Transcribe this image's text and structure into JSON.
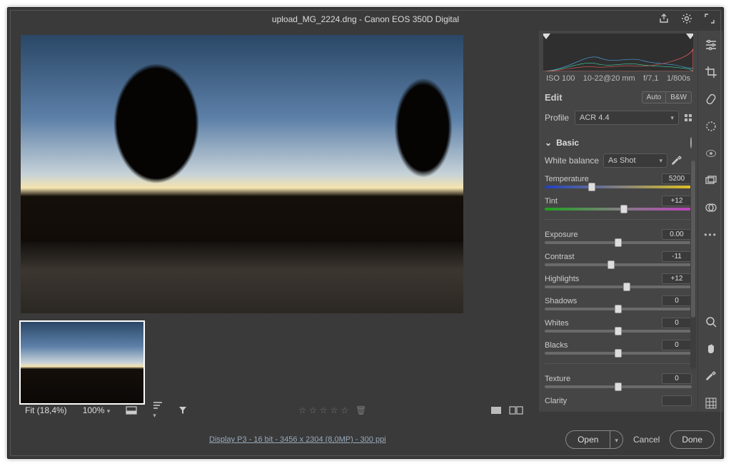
{
  "title": {
    "filename": "upload_MG_2224.dng",
    "sep": " - ",
    "camera": "Canon EOS 350D Digital"
  },
  "meta": {
    "iso": "ISO 100",
    "lens": "10-22@20 mm",
    "aperture": "f/7,1",
    "shutter": "1/800s"
  },
  "edit": {
    "label": "Edit",
    "auto": "Auto",
    "bw": "B&W",
    "profile_label": "Profile",
    "profile_value": "ACR 4.4"
  },
  "basic": {
    "heading": "Basic",
    "wb_label": "White balance",
    "wb_value": "As Shot",
    "sliders": {
      "temperature": {
        "label": "Temperature",
        "value": "5200",
        "pos": 32
      },
      "tint": {
        "label": "Tint",
        "value": "+12",
        "pos": 54
      },
      "exposure": {
        "label": "Exposure",
        "value": "0.00",
        "pos": 50
      },
      "contrast": {
        "label": "Contrast",
        "value": "-11",
        "pos": 45
      },
      "highlights": {
        "label": "Highlights",
        "value": "+12",
        "pos": 56
      },
      "shadows": {
        "label": "Shadows",
        "value": "0",
        "pos": 50
      },
      "whites": {
        "label": "Whites",
        "value": "0",
        "pos": 50
      },
      "blacks": {
        "label": "Blacks",
        "value": "0",
        "pos": 50
      },
      "texture": {
        "label": "Texture",
        "value": "0",
        "pos": 50
      },
      "clarity": {
        "label": "Clarity",
        "value": "",
        "pos": 50
      }
    }
  },
  "bottombar": {
    "fit": "Fit (18,4%)",
    "zoom": "100%"
  },
  "footer": {
    "display": "Display P3 - 16 bit - 3456 x 2304 (8,0MP) - 300 ppi",
    "open": "Open",
    "cancel": "Cancel",
    "done": "Done"
  }
}
